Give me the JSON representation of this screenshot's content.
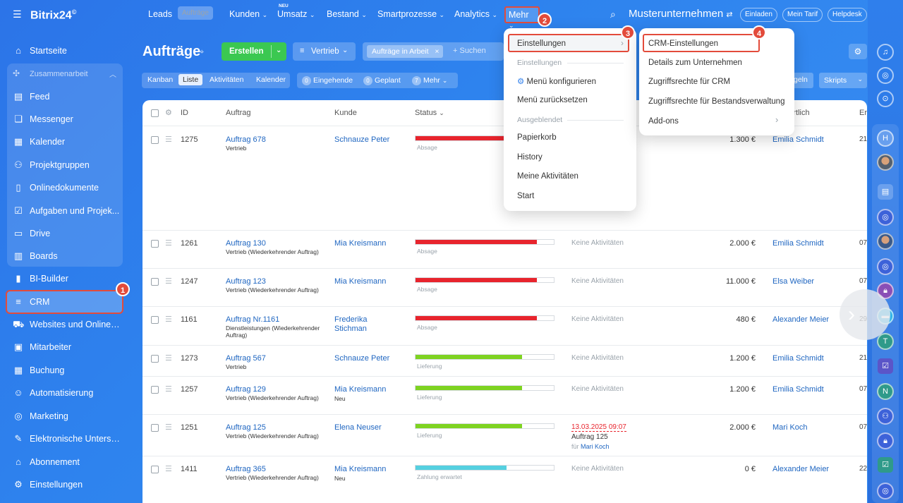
{
  "brand": {
    "logo": "Bitrix24",
    "logo_mark": "©"
  },
  "sidebar": {
    "group_label": "Zusammenarbeit",
    "items": [
      {
        "label": "Startseite",
        "icon": "home-icon"
      },
      {
        "label": "Feed",
        "icon": "feed-icon"
      },
      {
        "label": "Messenger",
        "icon": "chat-icon"
      },
      {
        "label": "Kalender",
        "icon": "calendar-icon"
      },
      {
        "label": "Projektgruppen",
        "icon": "group-icon"
      },
      {
        "label": "Onlinedokumente",
        "icon": "document-icon"
      },
      {
        "label": "Aufgaben und Projek...",
        "icon": "task-icon"
      },
      {
        "label": "Drive",
        "icon": "drive-icon"
      },
      {
        "label": "Boards",
        "icon": "board-icon"
      },
      {
        "label": "BI-Builder",
        "icon": "chart-icon"
      },
      {
        "label": "CRM",
        "icon": "filter-icon"
      },
      {
        "label": "Websites und Onlines...",
        "icon": "cart-icon"
      },
      {
        "label": "Mitarbeiter",
        "icon": "id-card-icon"
      },
      {
        "label": "Buchung",
        "icon": "booking-icon"
      },
      {
        "label": "Automatisierung",
        "icon": "robot-icon"
      },
      {
        "label": "Marketing",
        "icon": "marketing-icon"
      },
      {
        "label": "Elektronische Untersc...",
        "icon": "signature-icon"
      },
      {
        "label": "Abonnement",
        "icon": "subscription-icon"
      },
      {
        "label": "Einstellungen",
        "icon": "gear-icon"
      }
    ]
  },
  "topnav": {
    "items": [
      "Leads",
      "Aufträge",
      "Kunden",
      "Umsatz",
      "Bestand",
      "Smartprozesse",
      "Analytics"
    ],
    "neu_badge": "NEU",
    "mehr": "Mehr",
    "company": "Musterunternehmen",
    "buttons": [
      "Einladen",
      "Mein Tarif",
      "Helpdesk"
    ]
  },
  "header": {
    "title": "Aufträge",
    "create_label": "Erstellen",
    "pipeline_label": "Vertrieb",
    "filter_chip": "Aufträge in Arbeit",
    "search_placeholder": "+ Suchen",
    "regeln_label": "geln",
    "skripts_label": "Skripts"
  },
  "view_tabs": [
    "Kanban",
    "Liste",
    "Aktivitäten",
    "Kalender"
  ],
  "counters": [
    {
      "count": "0",
      "label": "Eingehende"
    },
    {
      "count": "0",
      "label": "Geplant"
    },
    {
      "count": "7",
      "label": "Mehr"
    }
  ],
  "table": {
    "columns": [
      "ID",
      "Auftrag",
      "Kunde",
      "Status",
      "antwortlich",
      "Er"
    ],
    "rows": [
      {
        "id": "1275",
        "deal": "Auftrag 678",
        "sub": "Vertrieb",
        "client": "Schnauze Peter",
        "client_sub": "",
        "status": "Absage",
        "progress": 0.85,
        "color": "#e8242d",
        "activity": "",
        "amount": "1.300 €",
        "resp": "Emilia Schmidt",
        "date": "21"
      },
      {
        "id": "1261",
        "deal": "Auftrag 130",
        "sub": "Vertrieb (Wiederkehrender Auftrag)",
        "client": "Mia Kreismann",
        "client_sub": "",
        "status": "Absage",
        "progress": 0.88,
        "color": "#e8242d",
        "activity": "Keine Aktivitäten",
        "amount": "2.000 €",
        "resp": "Emilia Schmidt",
        "date": "07"
      },
      {
        "id": "1247",
        "deal": "Auftrag 123",
        "sub": "Vertrieb (Wiederkehrender Auftrag)",
        "client": "Mia Kreismann",
        "client_sub": "",
        "status": "Absage",
        "progress": 0.88,
        "color": "#e8242d",
        "activity": "Keine Aktivitäten",
        "amount": "11.000 €",
        "resp": "Elsa Weiber",
        "date": "07"
      },
      {
        "id": "1161",
        "deal": "Auftrag Nr.1161",
        "sub": "Dienstleistungen (Wiederkehrender Auftrag)",
        "client": "Frederika Stichman",
        "client_sub": "",
        "status": "Absage",
        "progress": 0.88,
        "color": "#e8242d",
        "activity": "Keine Aktivitäten",
        "amount": "480 €",
        "resp": "Alexander Meier",
        "date": "29"
      },
      {
        "id": "1273",
        "deal": "Auftrag 567",
        "sub": "Vertrieb",
        "client": "Schnauze Peter",
        "client_sub": "",
        "status": "Lieferung",
        "progress": 0.77,
        "color": "#7ed321",
        "activity": "Keine Aktivitäten",
        "amount": "1.200 €",
        "resp": "Emilia Schmidt",
        "date": "21"
      },
      {
        "id": "1257",
        "deal": "Auftrag 129",
        "sub": "Vertrieb (Wiederkehrender Auftrag)",
        "client": "Mia Kreismann",
        "client_sub": "Neu",
        "status": "Lieferung",
        "progress": 0.77,
        "color": "#7ed321",
        "activity": "Keine Aktivitäten",
        "amount": "1.200 €",
        "resp": "Emilia Schmidt",
        "date": "07"
      },
      {
        "id": "1251",
        "deal": "Auftrag 125",
        "sub": "Vertrieb (Wiederkehrender Auftrag)",
        "client": "Elena Neuser",
        "client_sub": "",
        "status": "Lieferung",
        "progress": 0.77,
        "color": "#7ed321",
        "activity": "",
        "amount": "2.000 €",
        "resp": "Mari Koch",
        "date": "07"
      },
      {
        "id": "1411",
        "deal": "Auftrag 365",
        "sub": "Vertrieb (Wiederkehrender Auftrag)",
        "client": "Mia Kreismann",
        "client_sub": "Neu",
        "status": "Zahlung erwartet",
        "progress": 0.66,
        "color": "#55d0e0",
        "activity": "Keine Aktivitäten",
        "amount": "0 €",
        "resp": "Alexander Meier",
        "date": "22"
      }
    ],
    "activity_1251": {
      "datetime": "13.03.2025 09:07",
      "title": "Auftrag 125",
      "for_label": "für",
      "for_name": "Mari Koch"
    }
  },
  "mehr_menu": {
    "items": [
      {
        "label": "Einstellungen",
        "type": "submenu"
      },
      {
        "label": "Einstellungen",
        "type": "section"
      },
      {
        "label": "Menü konfigurieren",
        "type": "item"
      },
      {
        "label": "Menü zurücksetzen",
        "type": "item"
      },
      {
        "label": "Ausgeblendet",
        "type": "section"
      },
      {
        "label": "Papierkorb",
        "type": "item"
      },
      {
        "label": "History",
        "type": "item"
      },
      {
        "label": "Meine Aktivitäten",
        "type": "item"
      },
      {
        "label": "Start",
        "type": "item"
      }
    ]
  },
  "settings_submenu": {
    "items": [
      "CRM-Einstellungen",
      "Details zum Unternehmen",
      "Zugriffsrechte für CRM",
      "Zugriffsrechte für Bestandsverwaltung",
      "Add-ons"
    ]
  },
  "badges": [
    "1",
    "2",
    "3",
    "4"
  ],
  "rail": {
    "avatar_letters": [
      "H",
      "T",
      "N"
    ]
  },
  "colors": {
    "accent": "#2f7fec",
    "highlight": "#e34b3b",
    "create": "#3bc851",
    "absage": "#e8242d",
    "lieferung": "#7ed321",
    "zahlung": "#55d0e0"
  }
}
